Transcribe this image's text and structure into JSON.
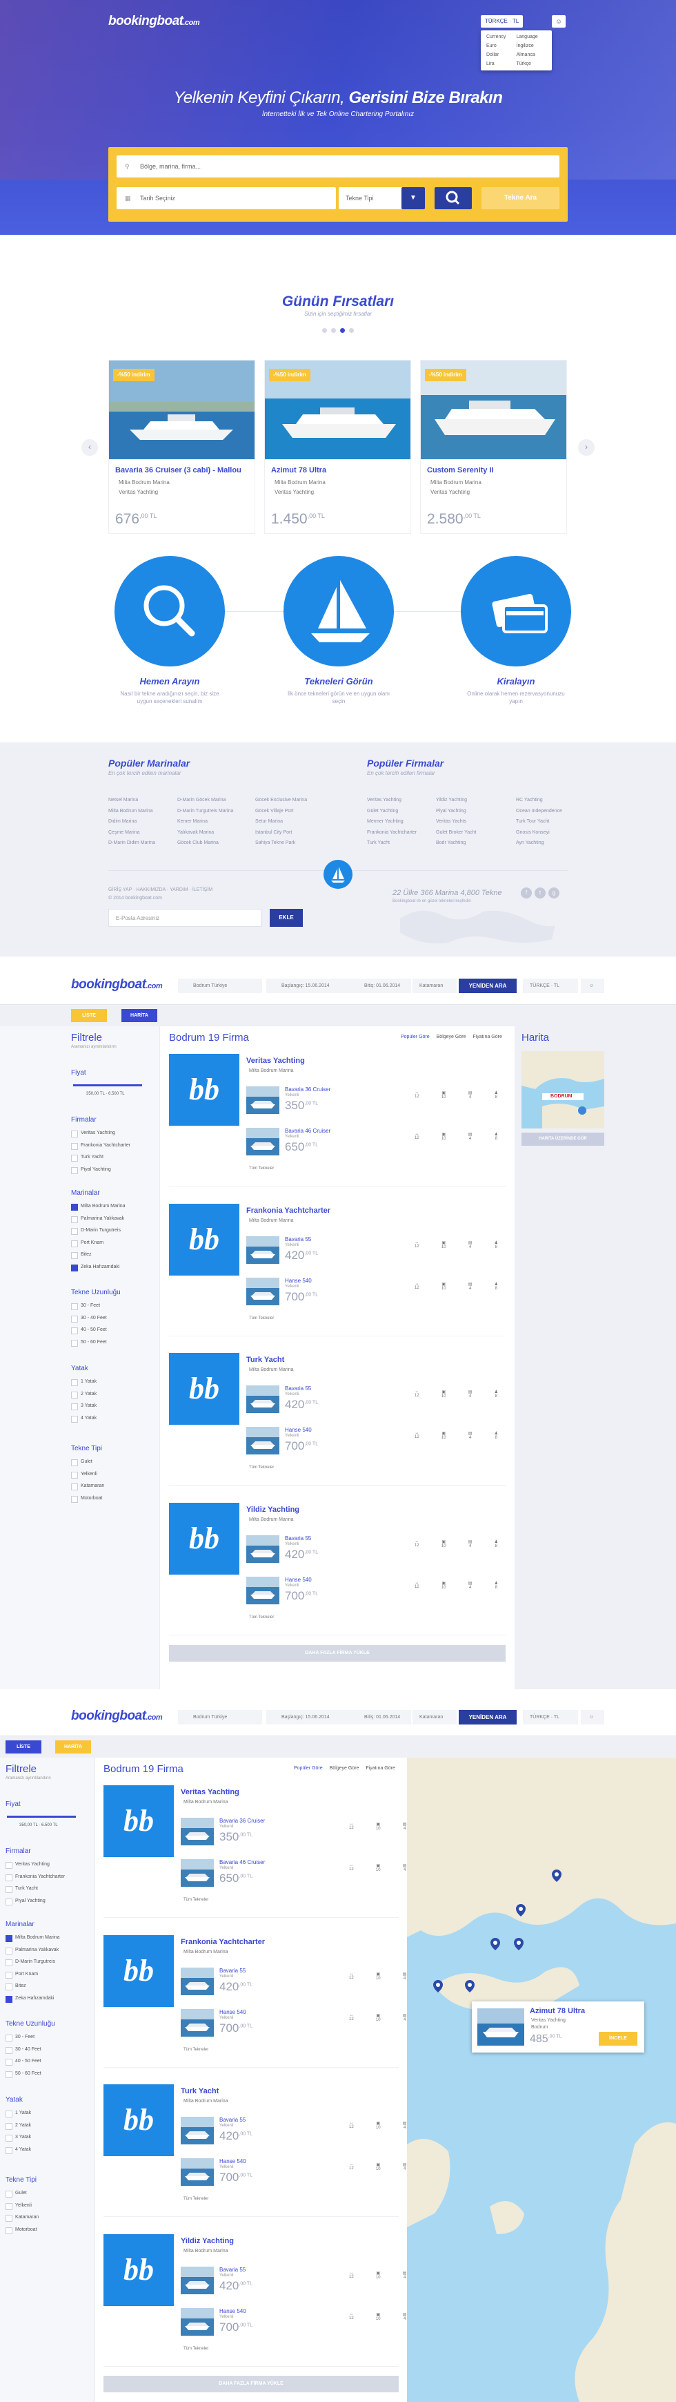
{
  "brand": {
    "logo": "bookingboat",
    "logo_suffix": ".com"
  },
  "colors": {
    "primary": "#3a49d1",
    "accent": "#f8c537",
    "blue": "#1e88e5",
    "dark_blue": "#2a3ea0"
  },
  "hero": {
    "lang_label": "TÜRKÇE · TL",
    "lang_options": [
      "Currency",
      "Language",
      "Euro",
      "İngilizce",
      "Dollar",
      "Almanca",
      "Lira",
      "Türkçe"
    ],
    "title_light": "Yelkenin Keyfini Çıkarın, ",
    "title_bold": "Gerisini Bize Bırakın",
    "subtitle": "İnternetteki İlk ve Tek Online Chartering Portalınız",
    "search_placeholder": "Bölge, marina, firma...",
    "date_placeholder": "Tarih Seçiniz",
    "boat_type_placeholder": "Tekne Tipi",
    "submit_label": "Tekne Ara"
  },
  "deals": {
    "title": "Günün Fırsatları",
    "subtitle": "Sizin için seçtiğimiz fırsatlar",
    "cards": [
      {
        "badge": "-%50 indirim",
        "name": "Bavaria 36 Cruiser (3 cabi) - Mallou",
        "marina": "Milta Bodrum Marina",
        "company": "Veritas Yachting",
        "price": "676",
        "cents": ",00 TL"
      },
      {
        "badge": "-%50 indirim",
        "name": "Azimut 78 Ultra",
        "marina": "Milta Bodrum Marina",
        "company": "Veritas Yachting",
        "price": "1.450",
        "cents": ",00 TL"
      },
      {
        "badge": "-%50 indirim",
        "name": "Custom Serenity II",
        "marina": "Milta Bodrum Marina",
        "company": "Veritas Yachting",
        "price": "2.580",
        "cents": ",00 TL"
      }
    ]
  },
  "steps": [
    {
      "title": "Hemen Arayın",
      "desc": "Nasıl bir tekne aradığınızı seçin, biz size uygun seçenekleri sunalım"
    },
    {
      "title": "Tekneleri Görün",
      "desc": "İlk önce tekneleri görün ve en uygun olanı seçin"
    },
    {
      "title": "Kiralayın",
      "desc": "Online olarak hemen rezervasyonunuzu yapın"
    }
  ],
  "popular": {
    "marinas_title": "Popüler Marinalar",
    "marinas_sub": "En çok tercih edilen marinalar",
    "marinas": [
      [
        "Netsel Marina",
        "Milta Bodrum Marina",
        "Didim Marina",
        "Çeşme Marina",
        "D-Marin Didim Marina"
      ],
      [
        "D-Marin Göcek Marina",
        "D-Marin Turgutreis Marina",
        "Kemer Marina",
        "Yalıkavak Marina",
        "Göcek Club Marina"
      ],
      [
        "Göcek Exclusive Marina",
        "Göcek Villaje Port",
        "Setur Marina",
        "Istanbul City Port",
        "Sahiya Tekne Park"
      ]
    ],
    "firms_title": "Popüler Firmalar",
    "firms_sub": "En çok tercih edilen firmalar",
    "firms": [
      [
        "Veritas Yachting",
        "Gület Yachting",
        "Mermer Yachting",
        "Frankonia Yachtcharter",
        "Turk Yacht"
      ],
      [
        "Yildiz Yachting",
        "Piyal Yachting",
        "Veritas Yachts",
        "Gulet Broker Yacht",
        "Bodr Yachting"
      ],
      [
        "RC Yachting",
        "Ocean Independence",
        "Turk Tour Yacht",
        "Gnosis Konseyi",
        "Ayn Yachting"
      ]
    ],
    "footer_links": "GİRİŞ YAP  ·  HAKKIMIZDA  ·  YARDIM  ·  İLETİŞİM",
    "copyright": "© 2014 bookingboat.com",
    "subscribe_placeholder": "E-Posta Adresiniz",
    "subscribe_btn": "EKLE",
    "stats": "22 Ülke 366 Marina 4,800 Tekne",
    "stats_sub": "Bookingboat ile en güzel tekneleri keşfedin"
  },
  "list": {
    "search_region": "Bodrum Türkiye",
    "start_date": "Başlangıç: 15.06.2014",
    "end_date": "Bitiş: 01.06.2014",
    "boat_type": "Katamaran",
    "search_btn": "YENİDEN ARA",
    "lang": "TÜRKÇE · TL",
    "view_list": "LİSTE",
    "view_map": "HARİTA",
    "filters_title": "Filtrele",
    "filters_sub": "Aramanızı ayrıntılandırın",
    "price_label": "Fiyat",
    "price_range": "350,00 TL  ·  6.500 TL",
    "firms_label": "Firmalar",
    "firms": [
      "Veritas Yachting",
      "Frankonia Yachtcharter",
      "Turk Yacht",
      "Piyal Yachting"
    ],
    "marinas_label": "Marinalar",
    "marinas": [
      "Milta Bodrum Marina",
      "Palmarina Yalıkavak",
      "D-Marin Turgutreis",
      "Port Knam",
      "Bitez",
      "Zeka Hafızamdaki"
    ],
    "length_label": "Tekne Uzunluğu",
    "lengths": [
      "30 - Feet",
      "30 - 40 Feet",
      "40 - 50 Feet",
      "50 - 60 Feet"
    ],
    "cabins_label": "Yatak",
    "cabins": [
      "1 Yatak",
      "2 Yatak",
      "3 Yatak",
      "4 Yatak"
    ],
    "types_label": "Tekne Tipi",
    "types": [
      "Gulet",
      "Yelkenli",
      "Katamaran",
      "Motorboat"
    ],
    "heading": "Bodrum 19 Firma",
    "sort": [
      "Popüler Göre",
      "Bölgeye Göre",
      "Fiyatına Göre"
    ],
    "spec_labels": [
      "12",
      "10",
      "4",
      "8",
      "28"
    ],
    "companies": [
      {
        "name": "Veritas Yachting",
        "marina": "Milta Bodrum Marina",
        "boats": [
          {
            "name": "Bavaria 36 Cruiser",
            "type": "Yelkenli",
            "price": "350",
            "cents": ",00 TL"
          },
          {
            "name": "Bavaria 46 Cruiser",
            "type": "Yelkenli",
            "price": "650",
            "cents": ",00 TL"
          }
        ]
      },
      {
        "name": "Frankonia Yachtcharter",
        "marina": "Milta Bodrum Marina",
        "boats": [
          {
            "name": "Bavaria 55",
            "type": "Yelkenli",
            "price": "420",
            "cents": ",00 TL"
          },
          {
            "name": "Hanse 540",
            "type": "Yelkenli",
            "price": "700",
            "cents": ",00 TL"
          }
        ]
      },
      {
        "name": "Turk Yacht",
        "marina": "Milta Bodrum Marina",
        "boats": [
          {
            "name": "Bavaria 55",
            "type": "Yelkenli",
            "price": "420",
            "cents": ",00 TL"
          },
          {
            "name": "Hanse 540",
            "type": "Yelkenli",
            "price": "700",
            "cents": ",00 TL"
          }
        ]
      },
      {
        "name": "Yildiz Yachting",
        "marina": "Milta Bodrum Marina",
        "boats": [
          {
            "name": "Bavaria 55",
            "type": "Yelkenli",
            "price": "420",
            "cents": ",00 TL"
          },
          {
            "name": "Hanse 540",
            "type": "Yelkenli",
            "price": "700",
            "cents": ",00 TL"
          }
        ]
      }
    ],
    "all_boats": "Tüm Tekneler",
    "more_btn": "DAHA FAZLA FİRMA YÜKLE",
    "map_title": "Harita",
    "map_label": "BODRUM",
    "map_btn": "HARİTA ÜZERİNDE GÖR",
    "popup": {
      "name": "Azimut 78 Ultra",
      "company": "Veritas Yachting",
      "marina": "Bodrum",
      "price": "485",
      "cents": ",00 TL",
      "btn": "İNCELE"
    }
  }
}
